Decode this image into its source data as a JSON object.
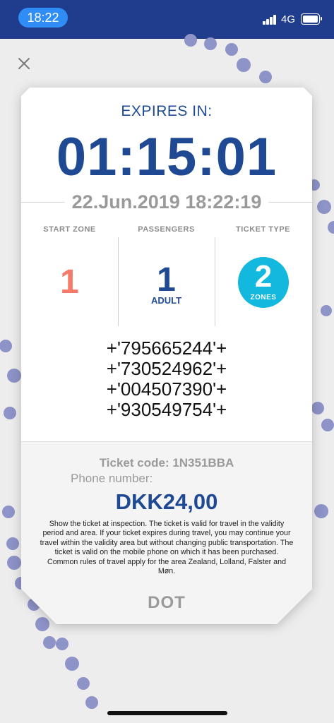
{
  "status_bar": {
    "time": "18:22",
    "network": "4G",
    "colors": {
      "bar": "#1f3d8c",
      "time_pill": "#2f8df5"
    }
  },
  "close_icon": "close-icon",
  "ticket": {
    "expires_label": "EXPIRES IN:",
    "countdown": "01:15:01",
    "date": "22.Jun.2019 18:22:19",
    "columns": [
      {
        "header": "START ZONE",
        "value": "1"
      },
      {
        "header": "PASSENGERS",
        "value": "1",
        "subvalue": "ADULT"
      },
      {
        "header": "TICKET TYPE",
        "value": "2",
        "subvalue": "ZONES"
      }
    ],
    "codes": [
      "+'795665244'+",
      "+'730524962'+",
      "+'004507390'+",
      "+'930549754'+"
    ],
    "ticket_code": "Ticket code: 1N351BBA",
    "phone_number_label": "Phone number:",
    "price": "DKK24,00",
    "terms": "Show the ticket at inspection. The ticket is valid for travel in the validity period and area. If your ticket expires during travel, you may continue your travel within the validity area but without changing public transportation. The ticket is valid on the mobile phone on which it has been purchased. Common rules of travel apply for the area Zealand, Lolland, Falster and Møn.",
    "brand": "DOT",
    "colors": {
      "primary": "#1f4a93",
      "start_zone": "#f47b6a",
      "zones_badge": "#12b8dd",
      "muted": "#9a9a9a"
    }
  }
}
